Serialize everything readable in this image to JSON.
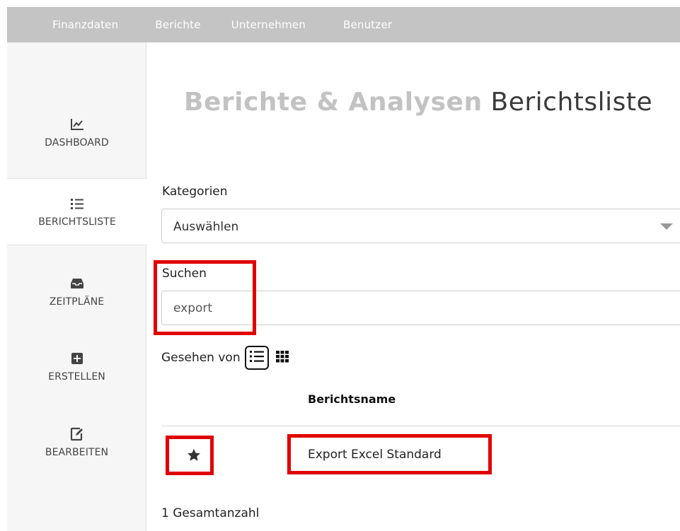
{
  "topnav": {
    "items": [
      "Finanzdaten",
      "Berichte",
      "Unternehmen",
      "Benutzer"
    ]
  },
  "sidebar": {
    "items": [
      {
        "label": "DASHBOARD",
        "icon": "chart-line-icon"
      },
      {
        "label": "BERICHTSLISTE",
        "icon": "list-icon"
      },
      {
        "label": "ZEITPLÄNE",
        "icon": "inbox-icon"
      },
      {
        "label": "ERSTELLEN",
        "icon": "plus-square-icon"
      },
      {
        "label": "BEARBEITEN",
        "icon": "edit-icon"
      }
    ],
    "active": "BERICHTSLISTE"
  },
  "header": {
    "title_bold": "Berichte & Analysen",
    "title_light": "Berichtsliste"
  },
  "filters": {
    "category_label": "Kategorien",
    "category_value": "Auswählen",
    "search_label": "Suchen",
    "search_value": "export"
  },
  "view": {
    "label": "Gesehen von",
    "modes": [
      "list-view-icon",
      "grid-view-icon"
    ],
    "active": "list-view-icon"
  },
  "table": {
    "columns": [
      "Berichtsname"
    ],
    "rows": [
      {
        "favorite": true,
        "name": "Export Excel Standard"
      }
    ]
  },
  "footer": {
    "total": "1 Gesamtanzahl"
  },
  "colors": {
    "topnav_bg": "#c4c4c4",
    "highlight": "#e00000",
    "sidebar_bg": "#f6f6f6"
  }
}
